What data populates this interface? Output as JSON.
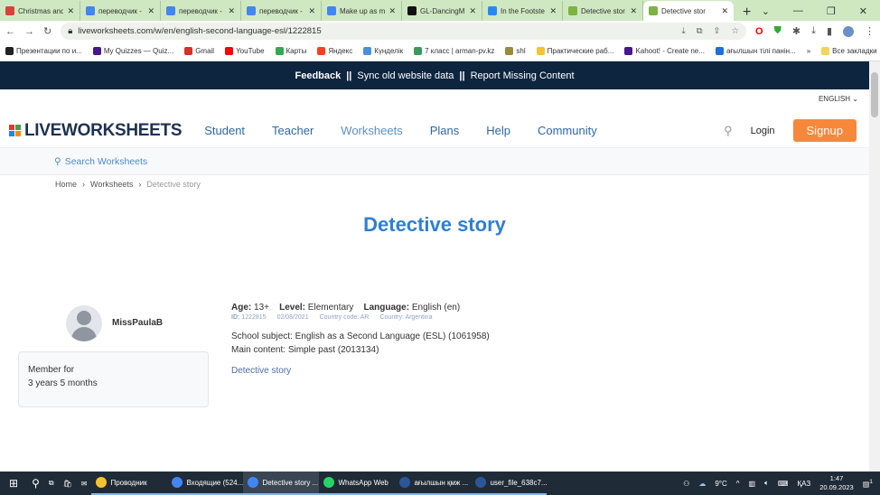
{
  "browser": {
    "tabs": [
      {
        "title": "Christmas and",
        "color": "#d9423a"
      },
      {
        "title": "переводчик -",
        "color": "#4285f4"
      },
      {
        "title": "переводчик -",
        "color": "#4285f4"
      },
      {
        "title": "переводчик -",
        "color": "#4285f4"
      },
      {
        "title": "Make up as m",
        "color": "#4285f4"
      },
      {
        "title": "GL-DancingM",
        "color": "#111111"
      },
      {
        "title": "In the Footste",
        "color": "#2787f5"
      },
      {
        "title": "Detective stor",
        "color": "#7cb342"
      },
      {
        "title": "Detective stor",
        "color": "#7cb342",
        "active": true
      }
    ],
    "url": "liveworksheets.com/w/en/english-second-language-esl/1222815",
    "bookmarks": [
      {
        "label": "Презентации по и...",
        "color": "#222"
      },
      {
        "label": "My Quizzes — Quiz...",
        "color": "#46178f"
      },
      {
        "label": "Gmail",
        "color": "#d93025"
      },
      {
        "label": "YouTube",
        "color": "#ff0000"
      },
      {
        "label": "Карты",
        "color": "#34a853"
      },
      {
        "label": "Яндекс",
        "color": "#fc3f1d"
      },
      {
        "label": "Күнделік",
        "color": "#4a90d9"
      },
      {
        "label": "7 класс | arman-pv.kz",
        "color": "#3b9a5b"
      },
      {
        "label": "shl",
        "color": "#9a8a3b"
      },
      {
        "label": "Практические раб...",
        "color": "#f4c430"
      },
      {
        "label": "Kahoot! - Create ne...",
        "color": "#46178f"
      },
      {
        "label": "ағылшын тілі панін...",
        "color": "#1e6fd9"
      }
    ],
    "bookmarks_more": "»",
    "all_bookmarks": "Все закладки"
  },
  "banner": {
    "feedback": "Feedback",
    "sep1": "||",
    "sync": "Sync old website data",
    "sep2": "||",
    "report": "Report Missing Content"
  },
  "language": "ENGLISH ⌄",
  "nav": {
    "logo": "LIVEWORKSHEETS",
    "links": [
      "Student",
      "Teacher",
      "Worksheets",
      "Plans",
      "Help",
      "Community"
    ],
    "login": "Login",
    "signup": "Signup",
    "accent": "#f7883a"
  },
  "search": {
    "placeholder": "Search Worksheets"
  },
  "breadcrumb": [
    "Home",
    "Worksheets",
    "Detective story"
  ],
  "title": "Detective story",
  "author": {
    "name": "MissPaulaB",
    "member_label": "Member for",
    "member_duration": "3 years 5 months"
  },
  "worksheet": {
    "age_label": "Age:",
    "age": "13+",
    "level_label": "Level:",
    "level": "Elementary",
    "language_label": "Language:",
    "language": "English (en)",
    "id_label": "ID:",
    "id": "1222815",
    "date": "02/08/2021",
    "country_code": "Country code: AR",
    "country": "Country: Argentina",
    "subject": "School subject: English as a Second Language (ESL) (1061958)",
    "content": "Main content: Simple past (2013134)",
    "link": "Detective story"
  },
  "taskbar": {
    "apps": [
      {
        "label": "Проводник",
        "color": "#f4c430"
      },
      {
        "label": "Входящие (524...",
        "color": "#4285f4"
      },
      {
        "label": "Detective story ...",
        "color": "#4285f4",
        "active": true
      },
      {
        "label": "WhatsApp Web",
        "color": "#25d366"
      },
      {
        "label": "ағылшын қмж ...",
        "color": "#2b579a"
      },
      {
        "label": "user_file_638c7...",
        "color": "#2b579a"
      }
    ],
    "weather": "9°C",
    "lang": "ҚАЗ",
    "time": "1:47",
    "date": "20.09.2023",
    "notifications": "1"
  }
}
